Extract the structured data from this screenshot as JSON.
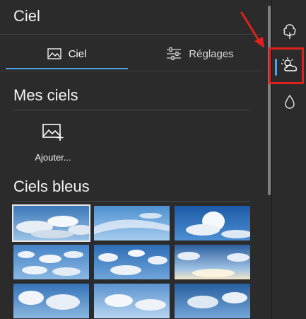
{
  "window": {
    "title": "Ciel"
  },
  "tabs": [
    {
      "label": "Ciel",
      "icon": "image-icon",
      "active": true
    },
    {
      "label": "Réglages",
      "icon": "sliders-icon",
      "active": false
    }
  ],
  "sections": {
    "my_skies": {
      "title": "Mes ciels",
      "add_label": "Ajouter..."
    },
    "blue_skies": {
      "title": "Ciels bleus"
    }
  },
  "thumbnails": [
    {
      "name": "blue-sky-1",
      "selected": true
    },
    {
      "name": "blue-sky-2",
      "selected": false
    },
    {
      "name": "blue-sky-3",
      "selected": false
    },
    {
      "name": "blue-sky-4",
      "selected": false
    },
    {
      "name": "blue-sky-5",
      "selected": false
    },
    {
      "name": "blue-sky-6",
      "selected": false
    },
    {
      "name": "blue-sky-7",
      "selected": false
    },
    {
      "name": "blue-sky-8",
      "selected": false
    },
    {
      "name": "blue-sky-9",
      "selected": false
    }
  ],
  "rail": [
    {
      "icon": "tree-icon",
      "active": false
    },
    {
      "icon": "partly-cloudy-icon",
      "active": true
    },
    {
      "icon": "drop-icon",
      "active": false
    }
  ],
  "colors": {
    "background": "#2b2b2b",
    "accent": "#4ea1e8",
    "annotation": "#e0201b"
  }
}
